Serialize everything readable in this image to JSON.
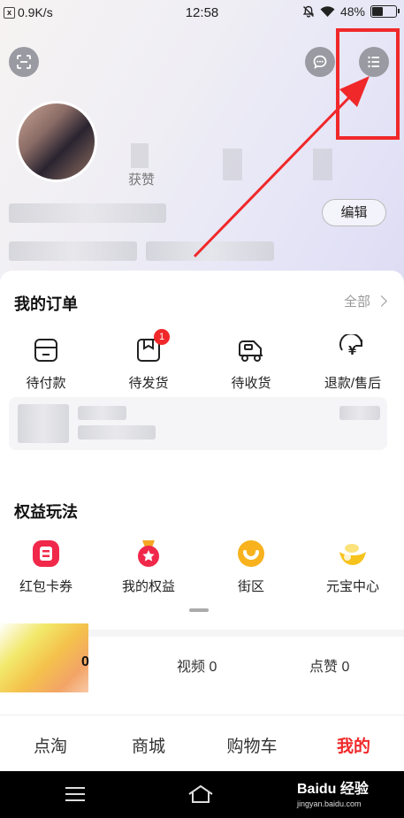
{
  "status_bar": {
    "speed": "0.9K/s",
    "time": "12:58",
    "battery": "48%",
    "battery_level": 0.48
  },
  "profile": {
    "likes_label": "获赞",
    "edit_label": "编辑"
  },
  "orders": {
    "title": "我的订单",
    "all_label": "全部",
    "items": [
      {
        "label": "待付款",
        "icon": "wallet-icon"
      },
      {
        "label": "待发货",
        "icon": "package-icon",
        "badge": "1"
      },
      {
        "label": "待收货",
        "icon": "truck-icon"
      },
      {
        "label": "退款/售后",
        "icon": "refund-icon"
      }
    ]
  },
  "benefits": {
    "title": "权益玩法",
    "items": [
      {
        "label": "红包卡券",
        "icon": "coupon-icon"
      },
      {
        "label": "我的权益",
        "icon": "medal-icon"
      },
      {
        "label": "街区",
        "icon": "smile-icon"
      },
      {
        "label": "元宝中心",
        "icon": "ingot-icon"
      }
    ]
  },
  "content_stats": {
    "first": "0",
    "videos": "视频 0",
    "likes": "点赞 0"
  },
  "bottom_nav": {
    "items": [
      "点淘",
      "商城",
      "购物车",
      "我的"
    ],
    "active_index": 3
  },
  "watermark": {
    "brand": "Baidu 经验",
    "url": "jingyan.baidu.com"
  },
  "colors": {
    "accent": "#f0282a"
  }
}
